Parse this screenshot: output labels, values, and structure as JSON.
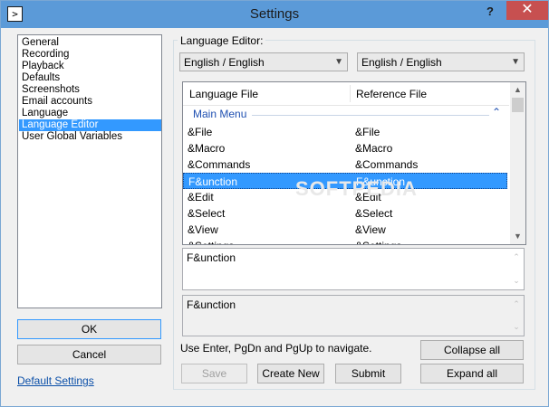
{
  "window": {
    "title": "Settings",
    "app_icon": "prompt-icon",
    "help_label": "?",
    "close_label": "✕"
  },
  "sidebar": {
    "items": [
      {
        "label": "General"
      },
      {
        "label": "Recording"
      },
      {
        "label": "Playback"
      },
      {
        "label": "Defaults"
      },
      {
        "label": "Screenshots"
      },
      {
        "label": "Email accounts"
      },
      {
        "label": "Language"
      },
      {
        "label": "Language Editor",
        "selected": true
      },
      {
        "label": "User Global Variables"
      }
    ],
    "ok_label": "OK",
    "cancel_label": "Cancel",
    "default_settings_link": "Default Settings"
  },
  "editor": {
    "group_label": "Language Editor:",
    "left_language": "English / English",
    "right_language": "English / English",
    "grid": {
      "headers": [
        "Language File",
        "Reference File"
      ],
      "group_title": "Main Menu",
      "rows": [
        {
          "lang": "&File",
          "ref": "&File"
        },
        {
          "lang": "&Macro",
          "ref": "&Macro"
        },
        {
          "lang": "&Commands",
          "ref": "&Commands"
        },
        {
          "lang": "F&unction",
          "ref": "F&unction",
          "selected": true
        },
        {
          "lang": "&Edit",
          "ref": "&Edit"
        },
        {
          "lang": "&Select",
          "ref": "&Select"
        },
        {
          "lang": "&View",
          "ref": "&View"
        },
        {
          "lang": "&Settings",
          "ref": "&Settings"
        }
      ]
    },
    "edit_text": "F&unction",
    "reference_text": "F&unction",
    "hint": "Use Enter, PgDn and PgUp to navigate.",
    "buttons": {
      "save": "Save",
      "create_new": "Create New",
      "submit": "Submit",
      "collapse_all": "Collapse all",
      "expand_all": "Expand all"
    }
  },
  "colors": {
    "titlebar": "#5b9ad8",
    "selection": "#3399ff",
    "close": "#c75050",
    "group_text": "#1e4fb1"
  },
  "watermark": "SOFTPEDIA"
}
